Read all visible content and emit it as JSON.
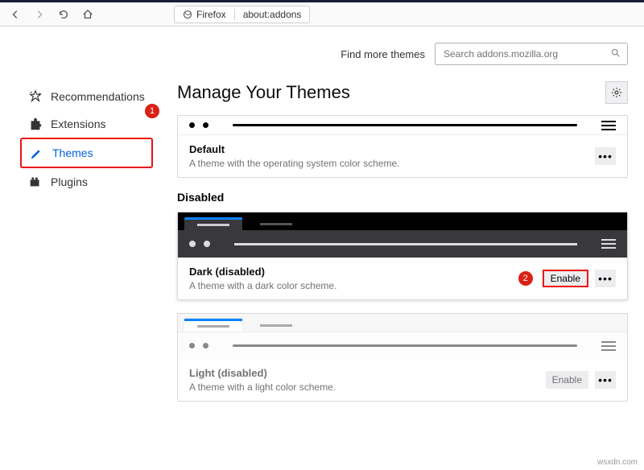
{
  "toolbar": {
    "browser_name": "Firefox",
    "url": "about:addons"
  },
  "topline": {
    "find_more": "Find more themes",
    "search_placeholder": "Search addons.mozilla.org"
  },
  "sidebar": {
    "items": [
      {
        "label": "Recommendations"
      },
      {
        "label": "Extensions"
      },
      {
        "label": "Themes"
      },
      {
        "label": "Plugins"
      }
    ],
    "badge1": "1"
  },
  "heading": "Manage Your Themes",
  "section_disabled": "Disabled",
  "themes": {
    "default": {
      "title": "Default",
      "desc": "A theme with the operating system color scheme."
    },
    "dark": {
      "title": "Dark (disabled)",
      "desc": "A theme with a dark color scheme.",
      "enable": "Enable",
      "badge": "2"
    },
    "light": {
      "title": "Light (disabled)",
      "desc": "A theme with a light color scheme.",
      "enable": "Enable"
    }
  },
  "dots": "•••",
  "watermark": "wsxdn.com"
}
